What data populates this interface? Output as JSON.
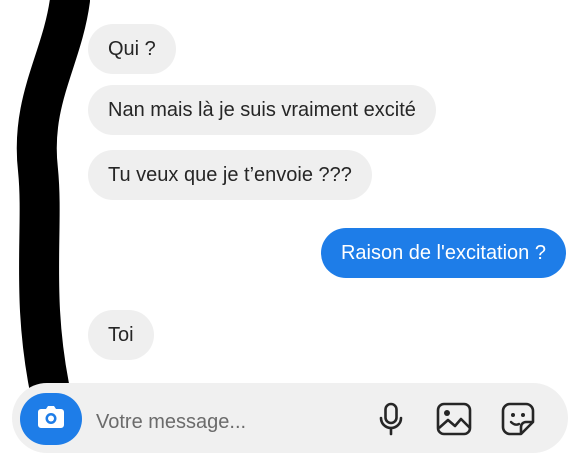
{
  "messages": [
    {
      "from": "them",
      "text": "Qui ?"
    },
    {
      "from": "them",
      "text": "Nan mais là je suis vraiment excité"
    },
    {
      "from": "them",
      "text": "Tu veux que je t’envoie ???"
    },
    {
      "from": "me",
      "text": "Raison de l'excitation ?"
    },
    {
      "from": "them",
      "text": "Toi"
    }
  ],
  "composer": {
    "placeholder": "Votre message...",
    "icons": [
      "camera-icon",
      "microphone-icon",
      "image-icon",
      "sticker-icon"
    ]
  },
  "colors": {
    "accent": "#1e7de8",
    "incoming_bubble": "#efefef",
    "composer_bg": "#f0f0f0"
  }
}
